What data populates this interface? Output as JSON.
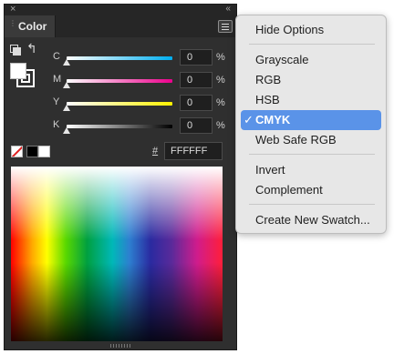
{
  "panel": {
    "title": "Color",
    "close_glyph": "×",
    "collapse_glyph": "‹‹",
    "channels": [
      {
        "label": "C",
        "value": "0",
        "unit": "%",
        "level": 0,
        "track_gradient": [
          "#ffffff",
          "#00aeef"
        ]
      },
      {
        "label": "M",
        "value": "0",
        "unit": "%",
        "level": 0,
        "track_gradient": [
          "#ffffff",
          "#ec008c"
        ]
      },
      {
        "label": "Y",
        "value": "0",
        "unit": "%",
        "level": 0,
        "track_gradient": [
          "#ffffff",
          "#fff200"
        ]
      },
      {
        "label": "K",
        "value": "0",
        "unit": "%",
        "level": 0,
        "track_gradient": [
          "#ffffff",
          "#000000"
        ]
      }
    ],
    "hex_label": "#",
    "hex_value": "FFFFFF",
    "fill_color": "#ffffff",
    "stroke_color": "#ffffff"
  },
  "menu": {
    "groups": [
      {
        "items": [
          {
            "label": "Hide Options",
            "checked": false
          }
        ]
      },
      {
        "items": [
          {
            "label": "Grayscale",
            "checked": false
          },
          {
            "label": "RGB",
            "checked": false
          },
          {
            "label": "HSB",
            "checked": false
          },
          {
            "label": "CMYK",
            "checked": true
          },
          {
            "label": "Web Safe RGB",
            "checked": false
          }
        ]
      },
      {
        "items": [
          {
            "label": "Invert",
            "checked": false
          },
          {
            "label": "Complement",
            "checked": false
          }
        ]
      },
      {
        "items": [
          {
            "label": "Create New Swatch...",
            "checked": false
          }
        ]
      }
    ],
    "check_glyph": "✓",
    "selection_color": "#5a93e8"
  }
}
